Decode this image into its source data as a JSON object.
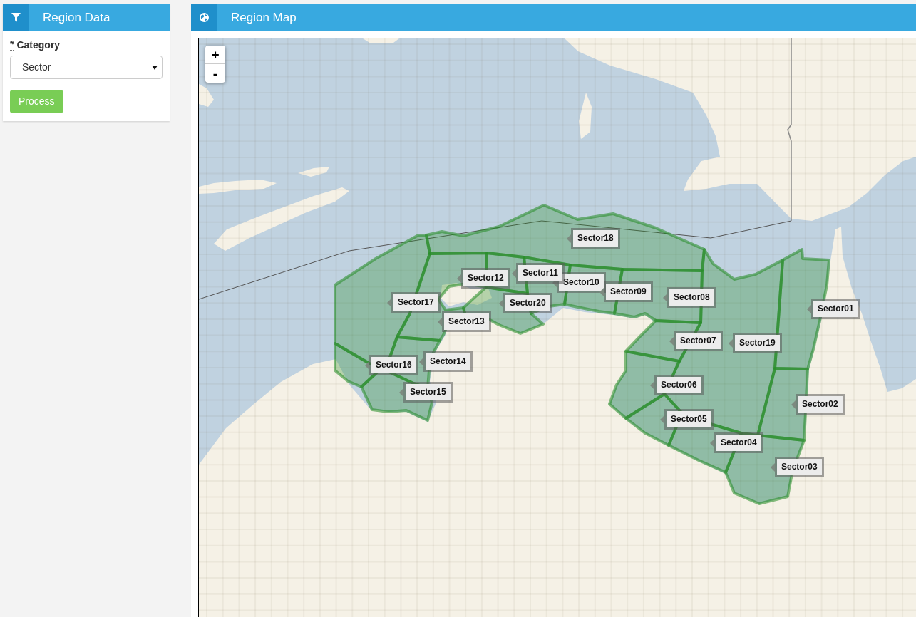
{
  "sidebar_panel": {
    "title": "Region Data",
    "field": {
      "required_mark": "*",
      "label": "Category",
      "value": "Sector"
    },
    "button": "Process"
  },
  "map_panel": {
    "title": "Region Map",
    "zoom_controls": [
      "+",
      "-"
    ],
    "sector_labels": [
      "Sector18",
      "Sector11",
      "Sector12",
      "Sector10",
      "Sector09",
      "Sector08",
      "Sector17",
      "Sector20",
      "Sector01",
      "Sector13",
      "Sector07",
      "Sector19",
      "Sector16",
      "Sector14",
      "Sector06",
      "Sector15",
      "Sector02",
      "Sector05",
      "Sector04",
      "Sector03"
    ]
  }
}
